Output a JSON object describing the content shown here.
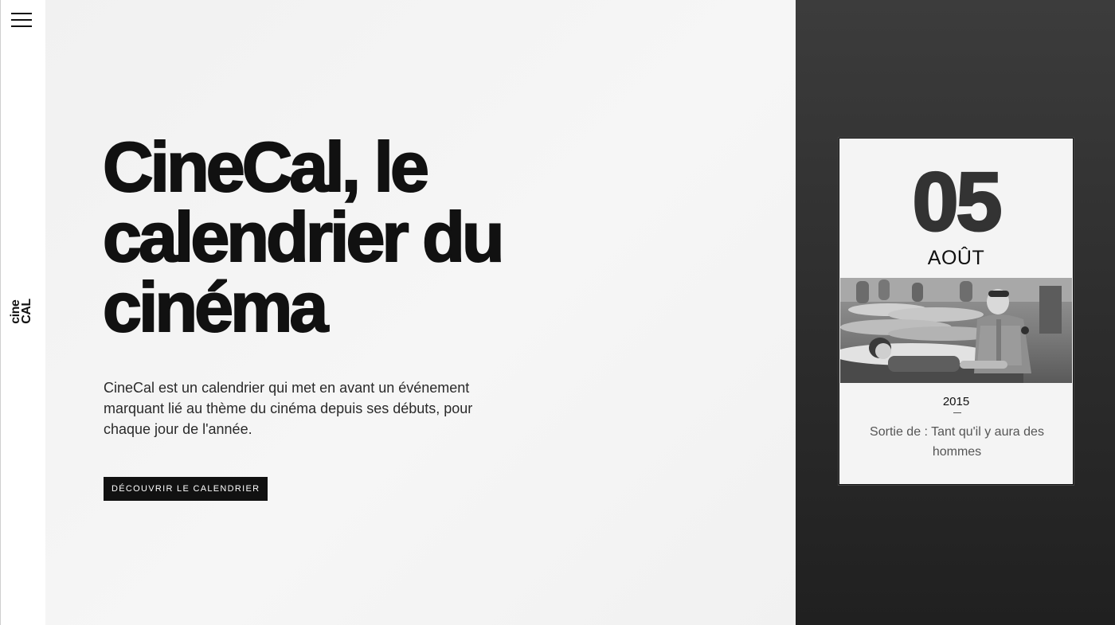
{
  "rail": {
    "menu_icon": "hamburger-menu-icon",
    "logo_line1": "cine",
    "logo_line2": "CAL"
  },
  "hero": {
    "title": "CineCal, le calendrier du cinéma",
    "description": "CineCal est un calendrier qui met en avant un événement marquant lié au thème du cinéma depuis ses débuts, pour chaque jour de l'année.",
    "cta_label": "DÉCOUVRIR LE CALENDRIER"
  },
  "card": {
    "day": "05",
    "month": "AOÛT",
    "year": "2015",
    "event": "Sortie de : Tant qu'il y aura des hommes"
  },
  "colors": {
    "hero_bg": "#f3f3f3",
    "dark_panel": "#2f2f2f",
    "text": "#111111",
    "button_bg": "#111111"
  }
}
